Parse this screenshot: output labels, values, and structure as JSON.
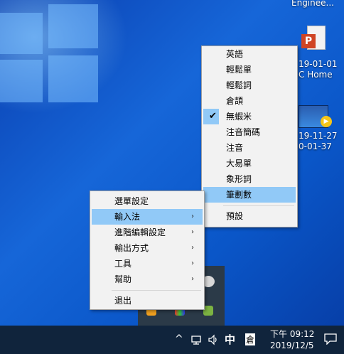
{
  "desktop": {
    "label_top": "Enginee...",
    "icon1_lines": [
      "19-01-01",
      "C Home"
    ],
    "icon2_lines": [
      "19-11-27",
      "0-01-37"
    ],
    "icon1_badge": "P"
  },
  "ime_menu": {
    "items": [
      {
        "label": "英語"
      },
      {
        "label": "輕鬆單"
      },
      {
        "label": "輕鬆詞"
      },
      {
        "label": "倉頡"
      },
      {
        "label": "無蝦米",
        "checked": true
      },
      {
        "label": "注音簡碼"
      },
      {
        "label": "注音"
      },
      {
        "label": "大易單"
      },
      {
        "label": "象形詞"
      },
      {
        "label": "筆劃數",
        "highlighted": true
      },
      {
        "label": "預設"
      }
    ],
    "check_mark": "✔"
  },
  "main_menu": {
    "items": [
      {
        "label": "選單設定"
      },
      {
        "label": "輸入法",
        "submenu": true,
        "highlighted": true
      },
      {
        "label": "進階編輯設定",
        "submenu": true
      },
      {
        "label": "輸出方式",
        "submenu": true
      },
      {
        "label": "工具",
        "submenu": true
      },
      {
        "label": "幫助",
        "submenu": true
      },
      {
        "label": "退出"
      }
    ],
    "arrow": "›"
  },
  "taskbar": {
    "chevron": "^",
    "ime_mode": "中",
    "ime_name": "倉",
    "time": "下午 09:12",
    "date": "2019/12/5"
  },
  "colors": {
    "highlight": "#91c9f7",
    "taskbar": "#10243c",
    "menu_bg": "#f2f2f2"
  }
}
